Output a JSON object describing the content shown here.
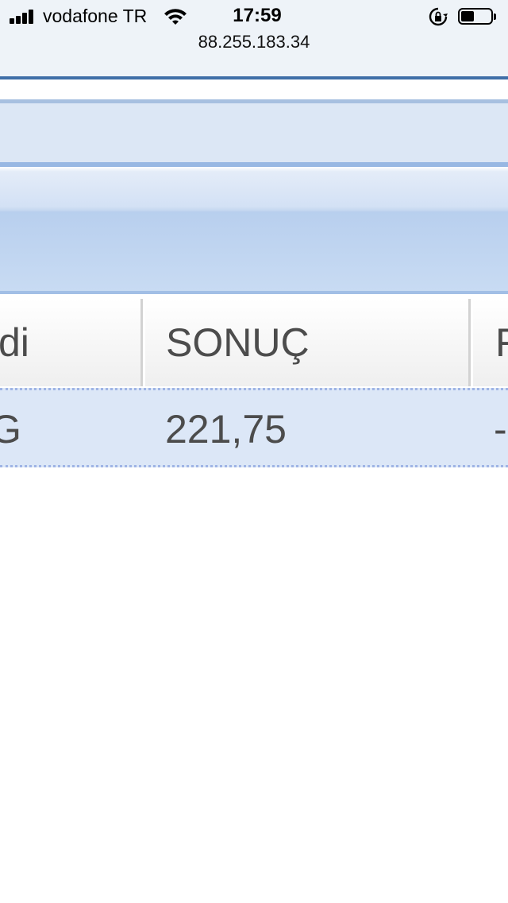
{
  "status_bar": {
    "carrier": "vodafone TR",
    "time": "17:59",
    "url": "88.255.183.34",
    "battery_level": 0.45
  },
  "table": {
    "columns": [
      "di",
      "SONUÇ",
      "F"
    ],
    "rows": [
      [
        "G",
        "221,75",
        "-"
      ]
    ]
  },
  "colors": {
    "header_line": "#3f6fa8",
    "band_light": "#dce7f5",
    "band_mid": "#c0d4ef",
    "row_background": "#dce7f7",
    "text": "#4c4c4c"
  }
}
